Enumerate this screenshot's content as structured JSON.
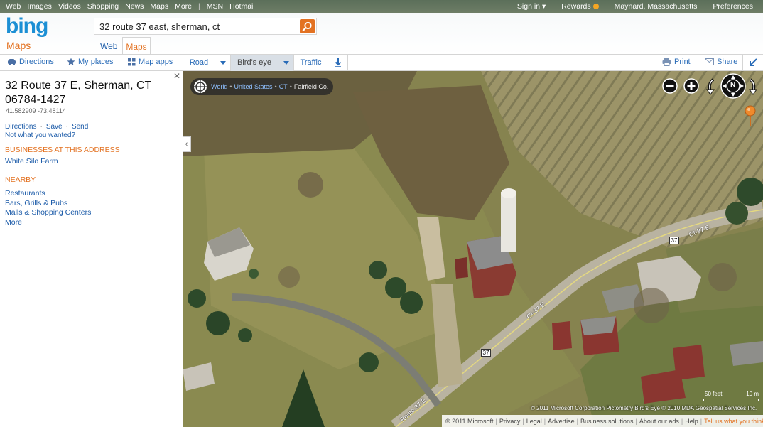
{
  "topbar": {
    "left_links": [
      "Web",
      "Images",
      "Videos",
      "Shopping",
      "News",
      "Maps",
      "More"
    ],
    "msn": "MSN",
    "hotmail": "Hotmail",
    "sign_in": "Sign in ▾",
    "rewards": "Rewards",
    "location": "Maynard, Massachusetts",
    "preferences": "Preferences"
  },
  "header": {
    "logo": "bing",
    "product": "Maps",
    "search_value": "32 route 37 east, sherman, ct",
    "tab_web": "Web",
    "tab_maps": "Maps"
  },
  "toolbar": {
    "directions": "Directions",
    "my_places": "My places",
    "map_apps": "Map apps",
    "road": "Road",
    "birds_eye": "Bird's eye",
    "traffic": "Traffic",
    "print": "Print",
    "share": "Share"
  },
  "panel": {
    "address_line1": "32 Route 37 E, Sherman, CT",
    "address_line2": "06784-1427",
    "coords": "41.582909 -73.48114",
    "link_directions": "Directions",
    "link_save": "Save",
    "link_send": "Send",
    "not_wanted": "Not what you wanted?",
    "businesses_heading": "BUSINESSES AT THIS ADDRESS",
    "business_1": "White Silo Farm",
    "nearby_heading": "NEARBY",
    "nearby": [
      "Restaurants",
      "Bars, Grills & Pubs",
      "Malls & Shopping Centers",
      "More"
    ]
  },
  "map": {
    "breadcrumb": [
      "World",
      "United States",
      "CT",
      "Fairfield Co."
    ],
    "road_label_1": "Ct-37 E",
    "road_label_2": "Ct-37 E",
    "road_label_3": "Route 37 E",
    "shield": "37",
    "copyright": "© 2011 Microsoft Corporation   Pictometry Bird's Eye © 2010 MDA Geospatial Services Inc.",
    "scale_feet": "50 feet",
    "scale_m": "10 m",
    "compass": "N"
  },
  "footer": {
    "items": [
      "© 2011 Microsoft",
      "Privacy",
      "Legal",
      "Advertise",
      "Business solutions",
      "About our ads",
      "Help"
    ],
    "tell_us": "Tell us what you think"
  },
  "colors": {
    "accent_orange": "#e37222",
    "link_blue": "#1a5aa8",
    "bing_blue": "#1c8fd4"
  }
}
